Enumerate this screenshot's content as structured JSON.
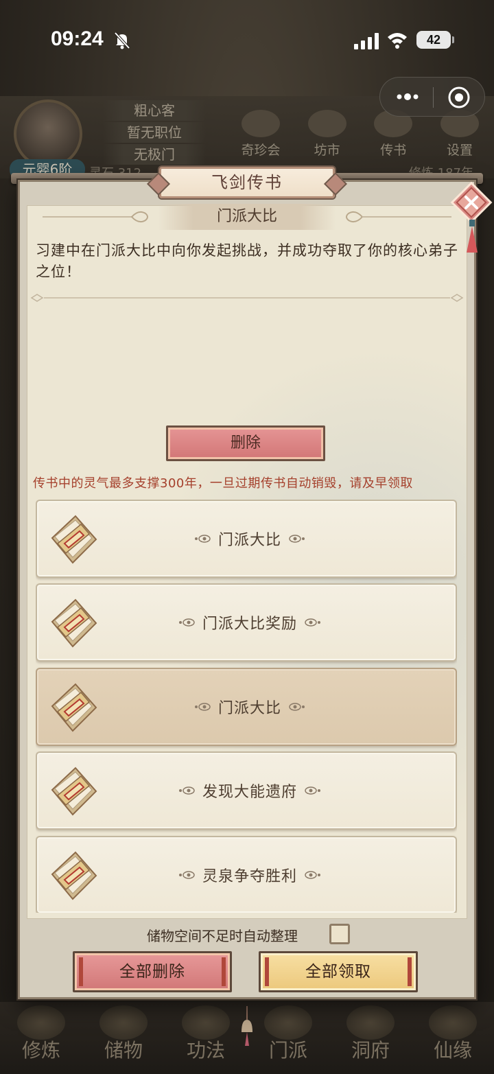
{
  "status_bar": {
    "time": "09:24",
    "battery": "42"
  },
  "background_game": {
    "player_info": [
      "粗心客",
      "暂无职位",
      "无极门"
    ],
    "realm_tag": "元婴6阶",
    "top_menu": [
      "奇珍会",
      "坊市",
      "传书",
      "设置"
    ],
    "resource_left": "灵石 312",
    "resource_right": "修炼 187年",
    "bottom_nav": [
      "修炼",
      "储物",
      "功法",
      "门派",
      "洞府",
      "仙缘"
    ]
  },
  "dialog": {
    "title": "飞剑传书",
    "letter": {
      "title": "门派大比",
      "body": "习建中在门派大比中向你发起挑战，并成功夺取了你的核心弟子之位！"
    },
    "delete_button": "删除",
    "expire_note": "传书中的灵气最多支撑300年，一旦过期传书自动销毁，请及早领取",
    "mail_items": [
      {
        "label": "门派大比",
        "selected": false
      },
      {
        "label": "门派大比奖励",
        "selected": false
      },
      {
        "label": "门派大比",
        "selected": true
      },
      {
        "label": "发现大能遗府",
        "selected": false
      },
      {
        "label": "灵泉争夺胜利",
        "selected": false
      }
    ],
    "auto_sort_label": "储物空间不足时自动整理",
    "auto_sort_checked": false,
    "delete_all_button": "全部删除",
    "claim_all_button": "全部领取"
  },
  "colors": {
    "accent_red": "#d27676",
    "accent_gold": "#ecc87c",
    "warning_text": "#a5402c",
    "panel_bg": "#ece6d3"
  }
}
